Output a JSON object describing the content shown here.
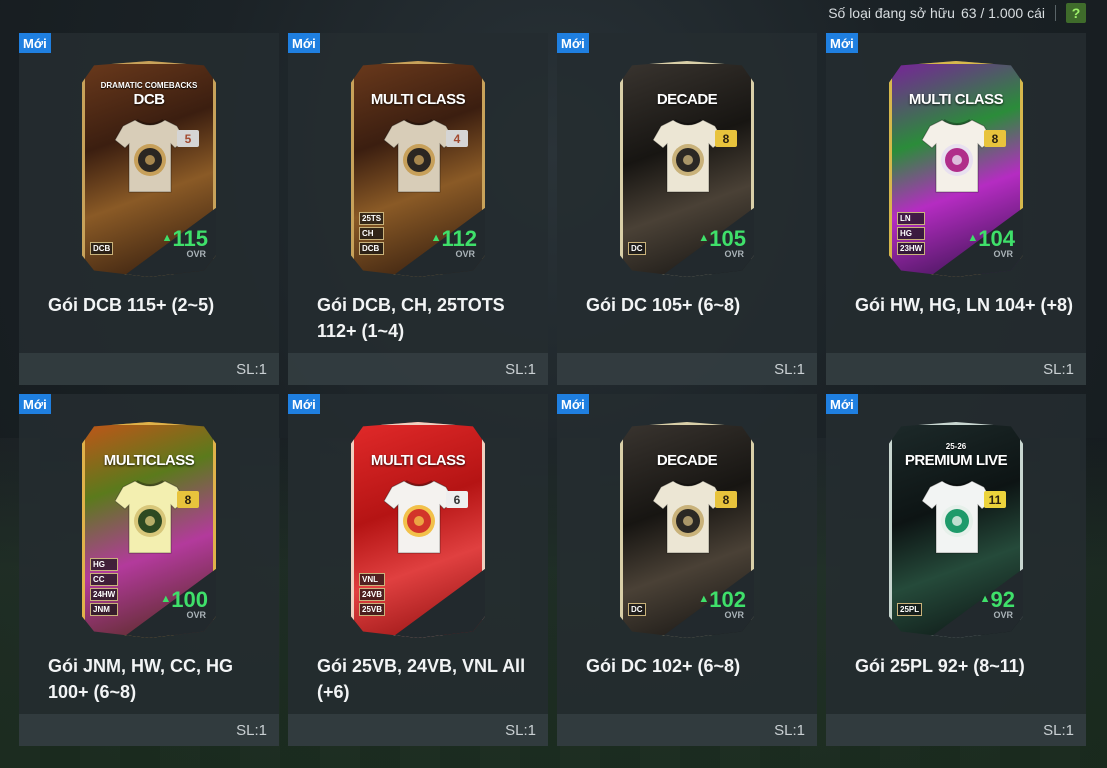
{
  "header": {
    "owned_label": "Số loại đang sở hữu",
    "owned_count": "63 / 1.000 cái",
    "help_label": "?"
  },
  "colors": {
    "ovr_green": "#3fe06a",
    "new_badge_blue": "#1f7fe0",
    "help_green": "#3f6b2b"
  },
  "packs": [
    {
      "badge": "Mới",
      "title": "Gói DCB 115+ (2~5)",
      "quantity": "SL:1",
      "card_sublabel": "DRAMATIC COMEBACKS",
      "card_label": "DCB",
      "grade": "5",
      "ovr": "115",
      "ovr_label": "OVR",
      "tags": [
        "DCB"
      ],
      "card_style": "bronze-gold",
      "shirt_icon": "shirt-icon"
    },
    {
      "badge": "Mới",
      "title": "Gói DCB, CH, 25TOTS 112+ (1~4)",
      "quantity": "SL:1",
      "card_sublabel": "",
      "card_label": "MULTI CLASS",
      "grade": "4",
      "ovr": "112",
      "ovr_label": "OVR",
      "tags": [
        "25TS",
        "CH",
        "DCB"
      ],
      "card_style": "bronze-gold",
      "shirt_icon": "shirt-icon"
    },
    {
      "badge": "Mới",
      "title": "Gói DC 105+ (6~8)",
      "quantity": "SL:1",
      "card_sublabel": "",
      "card_label": "DECADE",
      "grade": "8",
      "ovr": "105",
      "ovr_label": "OVR",
      "tags": [
        "DC"
      ],
      "card_style": "dark-gold",
      "shirt_icon": "shirt-icon"
    },
    {
      "badge": "Mới",
      "title": "Gói HW, HG, LN 104+ (+8)",
      "quantity": "SL:1",
      "card_sublabel": "",
      "card_label": "MULTI CLASS",
      "grade": "8",
      "ovr": "104",
      "ovr_label": "OVR",
      "tags": [
        "LN",
        "HG",
        "23HW"
      ],
      "card_style": "purple-green",
      "shirt_icon": "shirt-icon"
    },
    {
      "badge": "Mới",
      "title": "Gói JNM, HW, CC, HG 100+ (6~8)",
      "quantity": "SL:1",
      "card_sublabel": "",
      "card_label": "MULTICLASS",
      "grade": "8",
      "ovr": "100",
      "ovr_label": "OVR",
      "tags": [
        "HG",
        "CC",
        "24HW",
        "JNM"
      ],
      "card_style": "orange-purple",
      "shirt_icon": "shirt-icon"
    },
    {
      "badge": "Mới",
      "title": "Gói 25VB, 24VB, VNL All (+6)",
      "quantity": "SL:1",
      "card_sublabel": "",
      "card_label": "MULTI CLASS",
      "grade": "6",
      "ovr": "",
      "ovr_label": "",
      "tags": [
        "VNL",
        "24VB",
        "25VB"
      ],
      "card_style": "red",
      "shirt_icon": "shirt-icon"
    },
    {
      "badge": "Mới",
      "title": "Gói DC 102+ (6~8)",
      "quantity": "SL:1",
      "card_sublabel": "",
      "card_label": "DECADE",
      "grade": "8",
      "ovr": "102",
      "ovr_label": "OVR",
      "tags": [
        "DC"
      ],
      "card_style": "dark-gold",
      "shirt_icon": "shirt-icon"
    },
    {
      "badge": "Mới",
      "title": "Gói 25PL 92+ (8~11)",
      "quantity": "SL:1",
      "card_sublabel": "25-26",
      "card_label": "PREMIUM LIVE",
      "grade": "11",
      "ovr": "92",
      "ovr_label": "OVR",
      "tags": [
        "25PL"
      ],
      "card_style": "green-live",
      "shirt_icon": "shirt-icon"
    }
  ]
}
